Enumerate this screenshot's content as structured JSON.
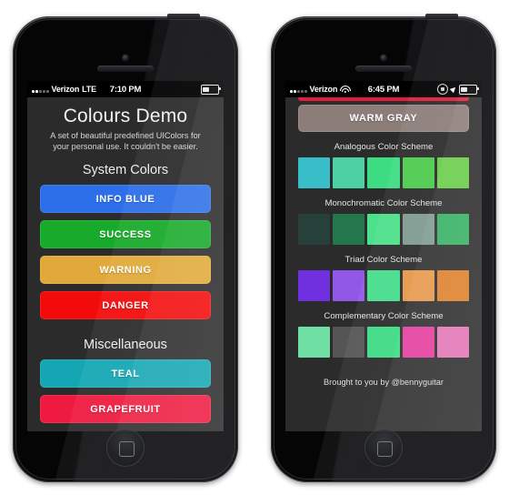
{
  "page": {
    "background": "#ffffff"
  },
  "phones": [
    {
      "name": "colours-demo-list",
      "status_bar": {
        "carrier": "Verizon",
        "network": "LTE",
        "time": "7:10 PM",
        "icons": [
          "signal-dots-icon",
          "battery-icon"
        ]
      },
      "app": {
        "title": "Colours Demo",
        "subtitle": "A set of beautiful predefined UIColors for your personal use. It couldn't be easier.",
        "sections": [
          {
            "heading": "System Colors",
            "buttons": [
              {
                "label": "INFO BLUE",
                "color": "#2d6fe8"
              },
              {
                "label": "SUCCESS",
                "color": "#18aa2a"
              },
              {
                "label": "WARNING",
                "color": "#e0a93a"
              },
              {
                "label": "DANGER",
                "color": "#f30a0a"
              }
            ]
          },
          {
            "heading": "Miscellaneous",
            "buttons": [
              {
                "label": "TEAL",
                "color": "#14a7b3"
              },
              {
                "label": "GRAPEFRUIT",
                "color": "#ee1a40"
              }
            ]
          }
        ]
      }
    },
    {
      "name": "colours-demo-schemes",
      "status_bar": {
        "carrier": "Verizon",
        "network": "",
        "time": "6:45 PM",
        "icons": [
          "signal-dots-icon",
          "wifi-icon",
          "rotation-lock-icon",
          "location-arrow-icon",
          "battery-icon"
        ]
      },
      "app": {
        "top_strip_color": "#e21d3f",
        "featured_button": {
          "label": "WARM GRAY",
          "color": "#8c7d79"
        },
        "schemes": [
          {
            "label": "Analogous Color Scheme",
            "colors": [
              "#38bec9",
              "#4cd0a4",
              "#3ddc83",
              "#4ccb4e",
              "#67cc46"
            ]
          },
          {
            "label": "Monochromatic Color Scheme",
            "colors": [
              "#27413a",
              "#23build",
              "#4ce08a",
              "#7e9a90",
              "#34b061"
            ]
          },
          {
            "label": "Triad Color Scheme",
            "colors": [
              "#7130e0",
              "#9158e8",
              "#45dd8b",
              "#e79749",
              "#dd7f28"
            ]
          },
          {
            "label": "Complementary Color Scheme",
            "colors": [
              "#6fdfa3",
              "#555555",
              "#3cdb83",
              "#e43a9c",
              "#e274b5"
            ]
          }
        ],
        "footer": "Brought to you by @bennyguitar"
      }
    }
  ]
}
